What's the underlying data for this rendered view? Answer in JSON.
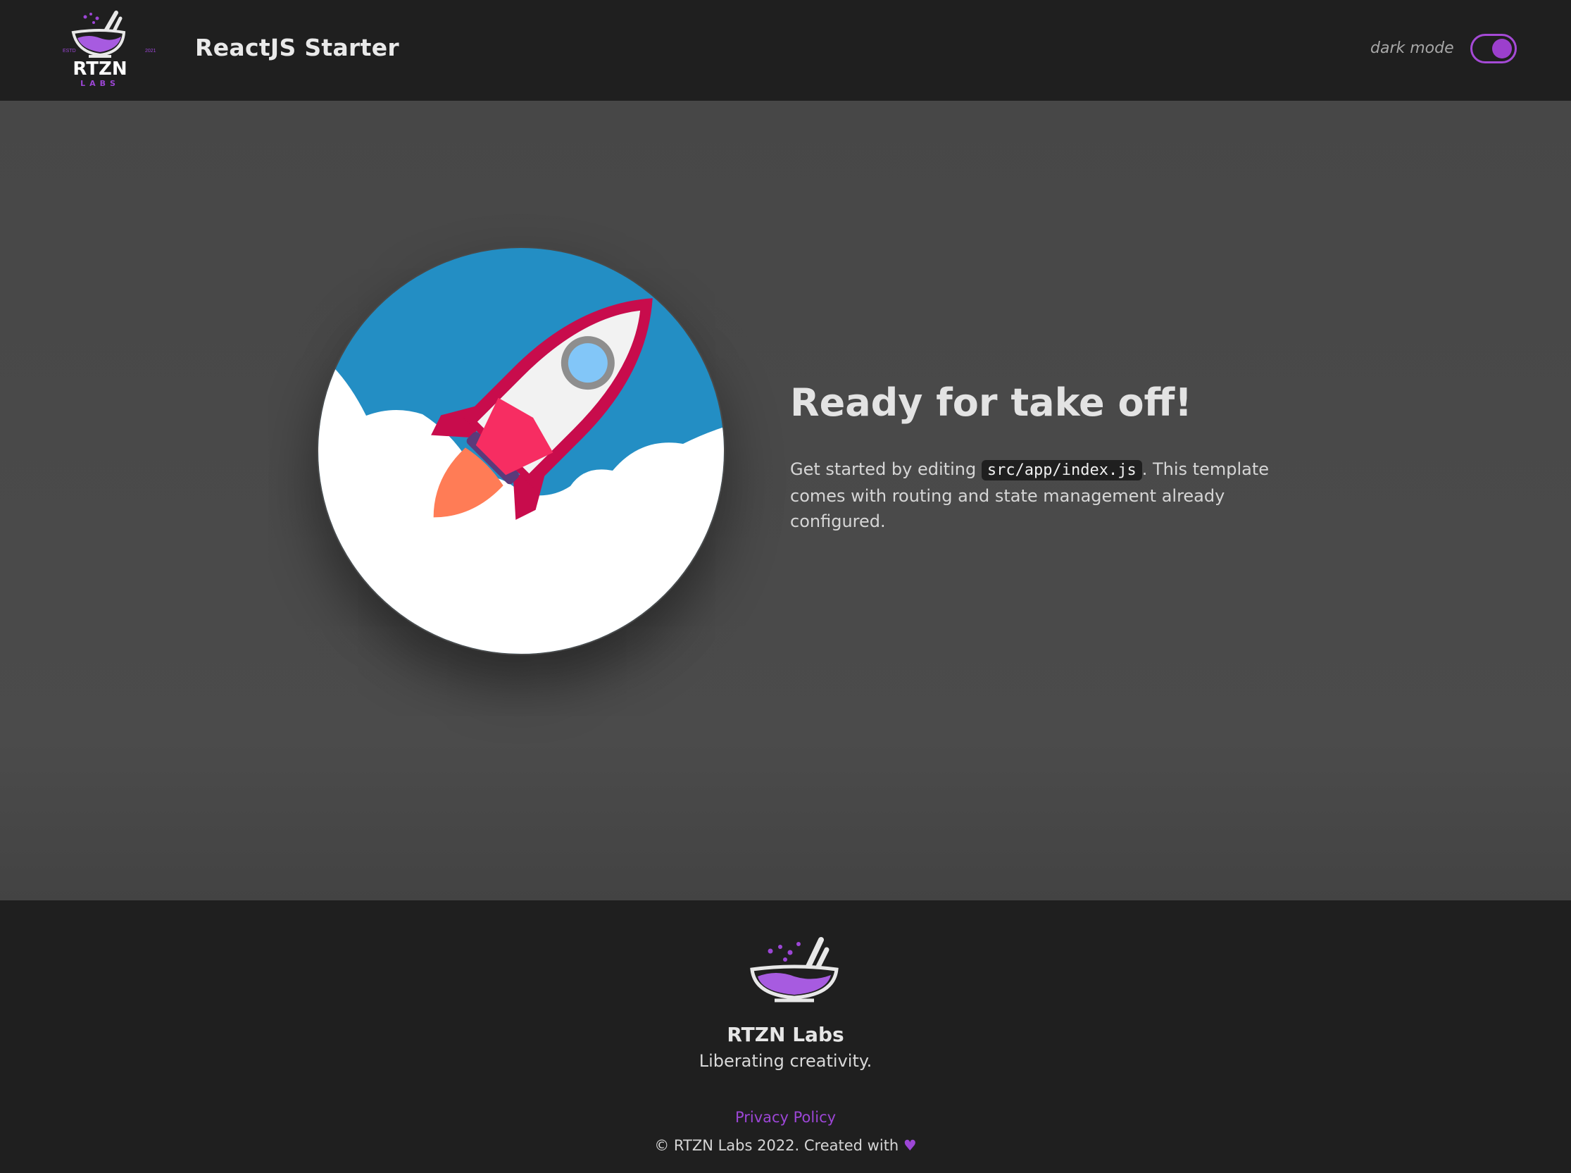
{
  "header": {
    "logo_text": "RTZN",
    "logo_subtext": "LABS",
    "logo_estd": "ESTD",
    "logo_year": "2021",
    "title": "ReactJS Starter",
    "dark_mode_label": "dark mode",
    "dark_mode_on": true
  },
  "hero": {
    "title": "Ready for take off!",
    "text_before": "Get started by editing ",
    "code": "src/app/index.js",
    "text_after": ". This template comes with routing and state management already configured.",
    "illustration_icon": "rocket-icon"
  },
  "footer": {
    "name": "RTZN Labs",
    "tagline": "Liberating creativity.",
    "privacy_label": "Privacy Policy",
    "copyright_text": "© RTZN Labs 2022. Created with",
    "heart_glyph": "♥"
  },
  "colors": {
    "accent": "#9c3fcd",
    "header_bg": "#1f1f1f",
    "main_bg": "#4a4a4a",
    "sky": "#238ec4",
    "rocket_red": "#c80c4c",
    "rocket_pink": "#f72d62",
    "flame": "#ff7c56"
  }
}
